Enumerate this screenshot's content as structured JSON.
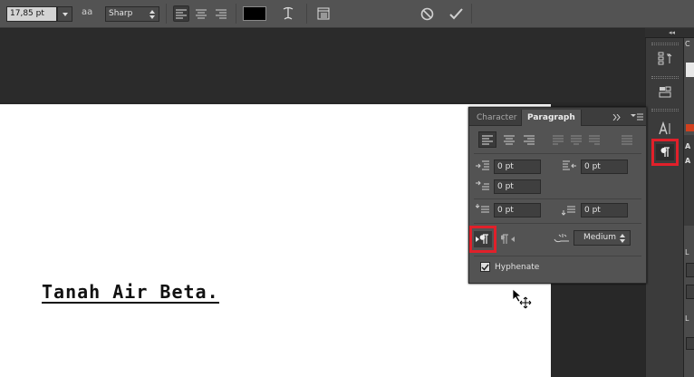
{
  "options_bar": {
    "font_size": "17,85 pt",
    "aa_label": "aa",
    "aa_method": "Sharp"
  },
  "document": {
    "text": "Tanah Air Beta."
  },
  "panel": {
    "tabs": [
      "Character",
      "Paragraph"
    ],
    "indent_left": "0 pt",
    "indent_right": "0 pt",
    "indent_first": "0 pt",
    "space_before": "0 pt",
    "space_after": "0 pt",
    "composer": "Medium",
    "hyphenate_label": "Hyphenate",
    "hyphenate_checked": true
  },
  "dock": {
    "collapse_glyph": "◂◂",
    "strip_letters": [
      "C",
      "A",
      "A",
      "L",
      "L"
    ]
  },
  "colors": {
    "highlight": "#e1202a",
    "text_color_swatch": "#000000"
  }
}
